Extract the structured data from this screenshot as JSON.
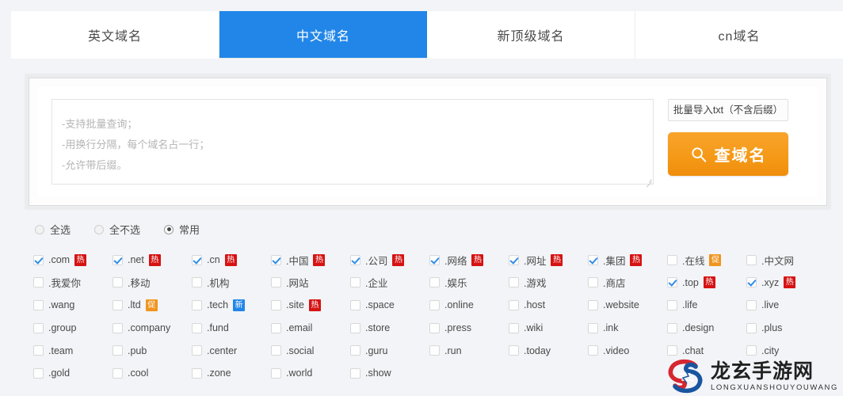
{
  "tabs": [
    {
      "label": "英文域名",
      "active": false
    },
    {
      "label": "中文域名",
      "active": true
    },
    {
      "label": "新顶级域名",
      "active": false
    },
    {
      "label": "cn域名",
      "active": false
    }
  ],
  "search": {
    "textarea_value": "",
    "textarea_placeholder": "-支持批量查询；\n-用换行分隔，每个域名占一行；\n-允许带后缀。",
    "import_label": "批量导入txt（不含后缀）",
    "search_label": "查域名",
    "search_icon": "magnifier-icon",
    "button_color": "#f59a18"
  },
  "select_modes": [
    {
      "label": "全选",
      "selected": false
    },
    {
      "label": "全不选",
      "selected": false
    },
    {
      "label": "常用",
      "selected": true
    }
  ],
  "badge_colors": {
    "hot": "#d61313",
    "promo": "#f0951f",
    "new": "#2186e8"
  },
  "suffixes": [
    {
      "label": ".com",
      "checked": true,
      "badge": "热",
      "badge_type": "hot"
    },
    {
      "label": ".net",
      "checked": true,
      "badge": "热",
      "badge_type": "hot"
    },
    {
      "label": ".cn",
      "checked": true,
      "badge": "热",
      "badge_type": "hot"
    },
    {
      "label": ".中国",
      "checked": true,
      "badge": "热",
      "badge_type": "hot"
    },
    {
      "label": ".公司",
      "checked": true,
      "badge": "热",
      "badge_type": "hot"
    },
    {
      "label": ".网络",
      "checked": true,
      "badge": "热",
      "badge_type": "hot"
    },
    {
      "label": ".网址",
      "checked": true,
      "badge": "热",
      "badge_type": "hot"
    },
    {
      "label": ".集团",
      "checked": true,
      "badge": "热",
      "badge_type": "hot"
    },
    {
      "label": ".在线",
      "checked": false,
      "badge": "促",
      "badge_type": "promo"
    },
    {
      "label": ".中文网",
      "checked": false,
      "badge": "",
      "badge_type": ""
    },
    {
      "label": ".我爱你",
      "checked": false,
      "badge": "",
      "badge_type": ""
    },
    {
      "label": ".移动",
      "checked": false,
      "badge": "",
      "badge_type": ""
    },
    {
      "label": ".机构",
      "checked": false,
      "badge": "",
      "badge_type": ""
    },
    {
      "label": ".网站",
      "checked": false,
      "badge": "",
      "badge_type": ""
    },
    {
      "label": ".企业",
      "checked": false,
      "badge": "",
      "badge_type": ""
    },
    {
      "label": ".娱乐",
      "checked": false,
      "badge": "",
      "badge_type": ""
    },
    {
      "label": ".游戏",
      "checked": false,
      "badge": "",
      "badge_type": ""
    },
    {
      "label": ".商店",
      "checked": false,
      "badge": "",
      "badge_type": ""
    },
    {
      "label": ".top",
      "checked": true,
      "badge": "热",
      "badge_type": "hot"
    },
    {
      "label": ".xyz",
      "checked": true,
      "badge": "热",
      "badge_type": "hot"
    },
    {
      "label": ".wang",
      "checked": false,
      "badge": "",
      "badge_type": ""
    },
    {
      "label": ".ltd",
      "checked": false,
      "badge": "促",
      "badge_type": "promo"
    },
    {
      "label": ".tech",
      "checked": false,
      "badge": "新",
      "badge_type": "new"
    },
    {
      "label": ".site",
      "checked": false,
      "badge": "热",
      "badge_type": "hot"
    },
    {
      "label": ".space",
      "checked": false,
      "badge": "",
      "badge_type": ""
    },
    {
      "label": ".online",
      "checked": false,
      "badge": "",
      "badge_type": ""
    },
    {
      "label": ".host",
      "checked": false,
      "badge": "",
      "badge_type": ""
    },
    {
      "label": ".website",
      "checked": false,
      "badge": "",
      "badge_type": ""
    },
    {
      "label": ".life",
      "checked": false,
      "badge": "",
      "badge_type": ""
    },
    {
      "label": ".live",
      "checked": false,
      "badge": "",
      "badge_type": ""
    },
    {
      "label": ".group",
      "checked": false,
      "badge": "",
      "badge_type": ""
    },
    {
      "label": ".company",
      "checked": false,
      "badge": "",
      "badge_type": ""
    },
    {
      "label": ".fund",
      "checked": false,
      "badge": "",
      "badge_type": ""
    },
    {
      "label": ".email",
      "checked": false,
      "badge": "",
      "badge_type": ""
    },
    {
      "label": ".store",
      "checked": false,
      "badge": "",
      "badge_type": ""
    },
    {
      "label": ".press",
      "checked": false,
      "badge": "",
      "badge_type": ""
    },
    {
      "label": ".wiki",
      "checked": false,
      "badge": "",
      "badge_type": ""
    },
    {
      "label": ".ink",
      "checked": false,
      "badge": "",
      "badge_type": ""
    },
    {
      "label": ".design",
      "checked": false,
      "badge": "",
      "badge_type": ""
    },
    {
      "label": ".plus",
      "checked": false,
      "badge": "",
      "badge_type": ""
    },
    {
      "label": ".team",
      "checked": false,
      "badge": "",
      "badge_type": ""
    },
    {
      "label": ".pub",
      "checked": false,
      "badge": "",
      "badge_type": ""
    },
    {
      "label": ".center",
      "checked": false,
      "badge": "",
      "badge_type": ""
    },
    {
      "label": ".social",
      "checked": false,
      "badge": "",
      "badge_type": ""
    },
    {
      "label": ".guru",
      "checked": false,
      "badge": "",
      "badge_type": ""
    },
    {
      "label": ".run",
      "checked": false,
      "badge": "",
      "badge_type": ""
    },
    {
      "label": ".today",
      "checked": false,
      "badge": "",
      "badge_type": ""
    },
    {
      "label": ".video",
      "checked": false,
      "badge": "",
      "badge_type": ""
    },
    {
      "label": ".chat",
      "checked": false,
      "badge": "",
      "badge_type": ""
    },
    {
      "label": ".city",
      "checked": false,
      "badge": "",
      "badge_type": ""
    },
    {
      "label": ".gold",
      "checked": false,
      "badge": "",
      "badge_type": ""
    },
    {
      "label": ".cool",
      "checked": false,
      "badge": "",
      "badge_type": ""
    },
    {
      "label": ".zone",
      "checked": false,
      "badge": "",
      "badge_type": ""
    },
    {
      "label": ".world",
      "checked": false,
      "badge": "",
      "badge_type": ""
    },
    {
      "label": ".show",
      "checked": false,
      "badge": "",
      "badge_type": ""
    }
  ],
  "watermark": {
    "cn": "龙玄手游网",
    "en": "LONGXUANSHOUYOUWANG",
    "logo_icon": "longxuan-s-logo-icon"
  }
}
